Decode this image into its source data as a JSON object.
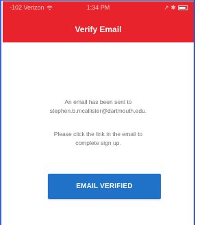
{
  "status_bar": {
    "carrier": "-102 Verizon",
    "time": "1:34 PM",
    "indicators": "↗ ✱"
  },
  "header": {
    "title": "Verify Email",
    "background_color": "#e8232b"
  },
  "message": {
    "line1": "An email has been sent to",
    "line2": "stephen.b.mcallister@dartmouth.edu.",
    "line3": "Please click the link in the email to",
    "line4": "complete sign up."
  },
  "button": {
    "label": "EMAIL VERIFIED",
    "color": "#1f72c8"
  },
  "icons": [
    "wifi-icon",
    "battery-icon"
  ]
}
